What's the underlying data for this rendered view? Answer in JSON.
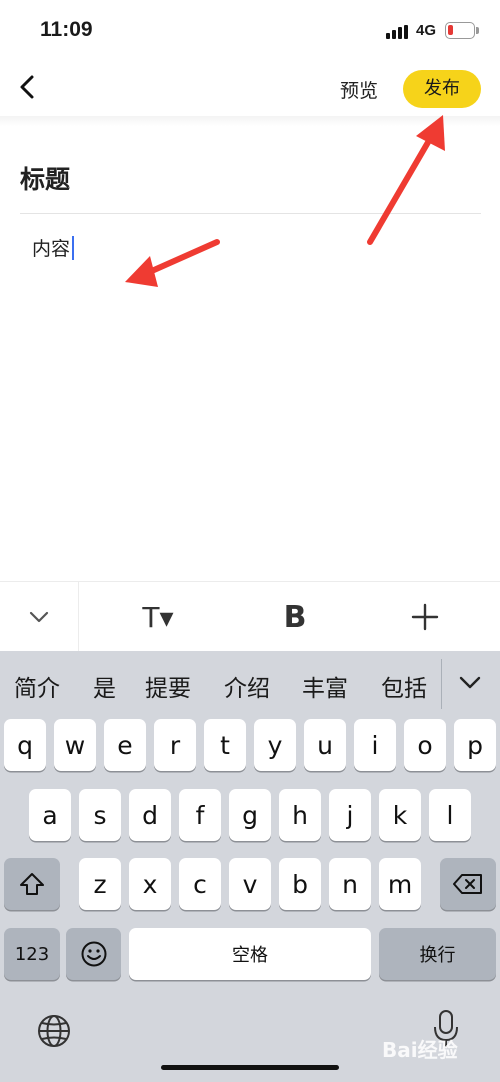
{
  "status": {
    "time": "11:09",
    "network": "4G",
    "battery_level": 0.2,
    "battery_color": "#e53935"
  },
  "nav": {
    "back_icon": "chevron-left-icon",
    "preview_label": "预览",
    "publish_label": "发布",
    "publish_color": "#f6d31a"
  },
  "editor": {
    "title_text": "标题",
    "content_text": "内容"
  },
  "toolbar": {
    "collapse_icon": "chevron-down-icon",
    "text_style_icon": "T▾",
    "bold_icon": "B",
    "add_icon": "plus-icon"
  },
  "keyboard": {
    "suggestions": [
      "简介",
      "是",
      "提要",
      "介绍",
      "丰富",
      "包括"
    ],
    "row1": [
      "q",
      "w",
      "e",
      "r",
      "t",
      "y",
      "u",
      "i",
      "o",
      "p"
    ],
    "row2": [
      "a",
      "s",
      "d",
      "f",
      "g",
      "h",
      "j",
      "k",
      "l"
    ],
    "row3": [
      "z",
      "x",
      "c",
      "v",
      "b",
      "n",
      "m"
    ],
    "num_key": "123",
    "space_label": "空格",
    "return_label": "换行"
  },
  "watermark": "Bai经验"
}
